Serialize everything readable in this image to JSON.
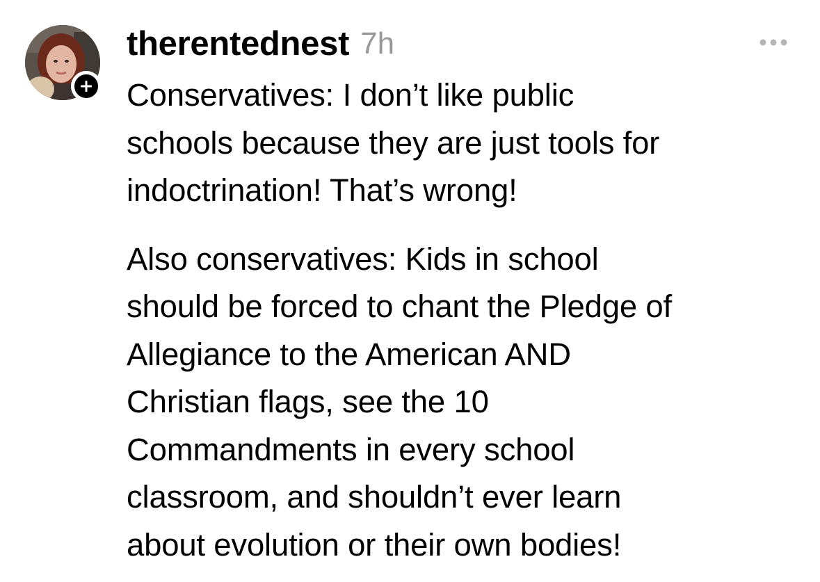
{
  "post": {
    "username": "therentednest",
    "timestamp": "7h",
    "icons": {
      "avatar": "profile-photo",
      "follow": "plus-icon",
      "more": "more-horizontal-icon"
    },
    "colors": {
      "text": "#000000",
      "timestamp": "#999999",
      "follow_button": "#000000",
      "more_icon": "#b3b3b3"
    },
    "paragraphs": [
      {
        "lines": [
          "Conservatives: I don’t like public",
          "schools because they are just tools for",
          "indoctrination! That’s wrong!"
        ]
      },
      {
        "lines": [
          "Also conservatives: Kids in school",
          "should be forced to chant the Pledge of",
          "Allegiance to the American AND",
          "Christian flags, see the 10",
          "Commandments in every school",
          "classroom, and shouldn’t ever learn",
          "about evolution or their own bodies!"
        ]
      }
    ]
  }
}
